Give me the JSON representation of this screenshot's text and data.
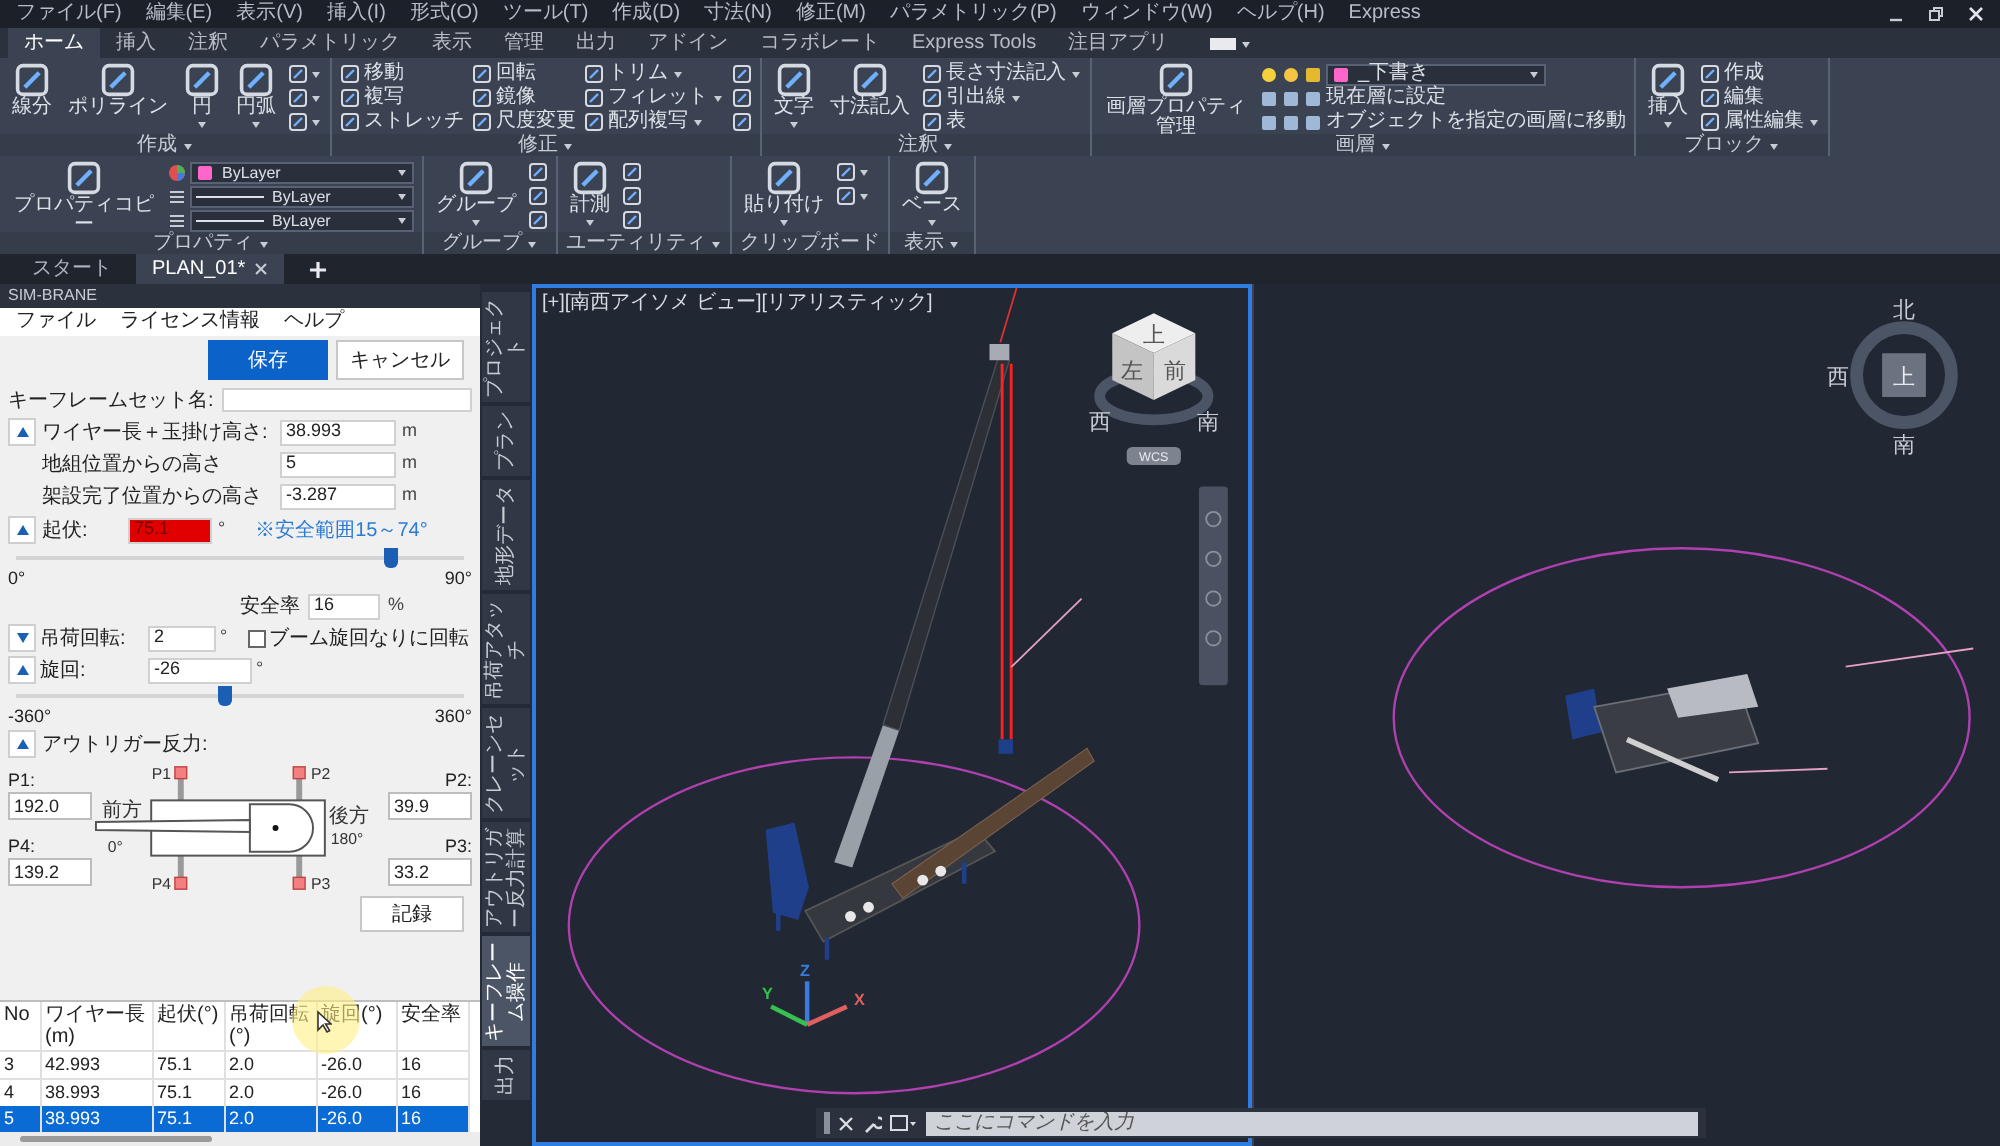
{
  "menu_bar": [
    "ファイル(F)",
    "編集(E)",
    "表示(V)",
    "挿入(I)",
    "形式(O)",
    "ツール(T)",
    "作成(D)",
    "寸法(N)",
    "修正(M)",
    "パラメトリック(P)",
    "ウィンドウ(W)",
    "ヘルプ(H)",
    "Express"
  ],
  "ribbon_tabs": [
    {
      "label": "ホーム",
      "selected": true
    },
    {
      "label": "挿入",
      "selected": false
    },
    {
      "label": "注釈",
      "selected": false
    },
    {
      "label": "パラメトリック",
      "selected": false
    },
    {
      "label": "表示",
      "selected": false
    },
    {
      "label": "管理",
      "selected": false
    },
    {
      "label": "出力",
      "selected": false
    },
    {
      "label": "アドイン",
      "selected": false
    },
    {
      "label": "コラボレート",
      "selected": false
    },
    {
      "label": "Express Tools",
      "selected": false
    },
    {
      "label": "注目アプリ",
      "selected": false
    }
  ],
  "ribbon_groups": [
    {
      "label": "作成",
      "menu": true,
      "columns": [
        [
          {
            "kind": "large",
            "label": "線分",
            "dropdown": false
          }
        ],
        [
          {
            "kind": "large",
            "label": "ポリライン",
            "dropdown": false
          }
        ],
        [
          {
            "kind": "large",
            "label": "円",
            "dropdown": true
          }
        ],
        [
          {
            "kind": "large",
            "label": "円弧",
            "dropdown": true
          }
        ],
        [
          {
            "kind": "icon",
            "dropdown": true
          },
          {
            "kind": "icon",
            "dropdown": true
          },
          {
            "kind": "icon",
            "dropdown": true
          }
        ]
      ]
    },
    {
      "label": "修正",
      "menu": true,
      "columns": [
        [
          {
            "kind": "small",
            "label": "移動",
            "dropdown": false
          },
          {
            "kind": "small",
            "label": "複写",
            "dropdown": false
          },
          {
            "kind": "small",
            "label": "ストレッチ",
            "dropdown": false
          }
        ],
        [
          {
            "kind": "small",
            "label": "回転",
            "dropdown": false
          },
          {
            "kind": "small",
            "label": "鏡像",
            "dropdown": false
          },
          {
            "kind": "small",
            "label": "尺度変更",
            "dropdown": false
          }
        ],
        [
          {
            "kind": "small",
            "label": "トリム",
            "dropdown": true
          },
          {
            "kind": "small",
            "label": "フィレット",
            "dropdown": true
          },
          {
            "kind": "small",
            "label": "配列複写",
            "dropdown": true
          }
        ],
        [
          {
            "kind": "icon",
            "dropdown": false
          },
          {
            "kind": "icon",
            "dropdown": false
          },
          {
            "kind": "icon",
            "dropdown": false
          }
        ]
      ]
    },
    {
      "label": "注釈",
      "menu": true,
      "columns": [
        [
          {
            "kind": "large",
            "label": "文字",
            "dropdown": true
          }
        ],
        [
          {
            "kind": "large",
            "label": "寸法記入",
            "dropdown": false
          }
        ],
        [
          {
            "kind": "small",
            "label": "長さ寸法記入",
            "dropdown": true
          },
          {
            "kind": "small",
            "label": "引出線",
            "dropdown": true
          },
          {
            "kind": "small",
            "label": "表",
            "dropdown": false
          }
        ]
      ]
    },
    {
      "label": "画層",
      "menu": true,
      "columns": [
        [
          {
            "kind": "large",
            "label": "画層プロパティ管理",
            "dropdown": false
          }
        ],
        [
          {
            "kind": "layer-select",
            "value": "_下書き",
            "dropdown": true
          },
          {
            "kind": "layer-tool",
            "label": "現在層に設定",
            "dropdown": false
          },
          {
            "kind": "layer-tool",
            "label": "オブジェクトを指定の画層に移動",
            "dropdown": false
          }
        ]
      ]
    },
    {
      "label": "ブロック",
      "menu": true,
      "columns": [
        [
          {
            "kind": "large",
            "label": "挿入",
            "dropdown": true
          }
        ],
        [
          {
            "kind": "small",
            "label": "作成",
            "dropdown": false
          },
          {
            "kind": "small",
            "label": "編集",
            "dropdown": false
          },
          {
            "kind": "small",
            "label": "属性編集",
            "dropdown": true
          }
        ]
      ]
    },
    {
      "label": "プロパティ",
      "menu": true,
      "columns": [
        [
          {
            "kind": "large",
            "label": "プロパティコピー",
            "dropdown": false
          }
        ],
        [
          {
            "kind": "color-select",
            "value": "ByLayer",
            "dropdown": true
          },
          {
            "kind": "line-select",
            "value": "ByLayer",
            "dropdown": true
          },
          {
            "kind": "line-select",
            "value": "ByLayer",
            "dropdown": true
          }
        ]
      ]
    },
    {
      "label": "グループ",
      "menu": true,
      "columns": [
        [
          {
            "kind": "large",
            "label": "グループ",
            "dropdown": true
          }
        ],
        [
          {
            "kind": "icon",
            "dropdown": false
          },
          {
            "kind": "icon",
            "dropdown": false
          },
          {
            "kind": "icon",
            "dropdown": false
          }
        ]
      ]
    },
    {
      "label": "ユーティリティ",
      "menu": true,
      "columns": [
        [
          {
            "kind": "large",
            "label": "計測",
            "dropdown": true
          }
        ],
        [
          {
            "kind": "icon",
            "dropdown": false
          },
          {
            "kind": "icon",
            "dropdown": false
          },
          {
            "kind": "icon",
            "dropdown": false
          }
        ]
      ]
    },
    {
      "label": "クリップボード",
      "menu": false,
      "columns": [
        [
          {
            "kind": "large",
            "label": "貼り付け",
            "dropdown": true
          }
        ],
        [
          {
            "kind": "icon",
            "dropdown": true
          },
          {
            "kind": "icon",
            "dropdown": true
          }
        ]
      ]
    },
    {
      "label": "表示",
      "menu": true,
      "columns": [
        [
          {
            "kind": "large",
            "label": "ベース",
            "dropdown": true
          }
        ]
      ]
    }
  ],
  "doc_tabs": [
    {
      "label": "スタート",
      "selected": false,
      "closable": false
    },
    {
      "label": "PLAN_01*",
      "selected": true,
      "closable": true
    }
  ],
  "sim_panel": {
    "title": "SIM-BRANE",
    "menus": [
      "ファイル",
      "ライセンス情報",
      "ヘルプ"
    ],
    "buttons": [
      {
        "label": "保存",
        "primary": true
      },
      {
        "label": "キャンセル",
        "primary": false
      }
    ],
    "keyframe_set": {
      "label": "キーフレームセット名:"
    },
    "wire": {
      "expanded": true,
      "rows": [
        {
          "label": "ワイヤー長＋玉掛け高さ:",
          "value": "38.993",
          "unit": "m"
        },
        {
          "label": "地組位置からの高さ",
          "value": "5",
          "unit": "m"
        },
        {
          "label": "架設完了位置からの高さ",
          "value": "-3.287",
          "unit": "m"
        }
      ]
    },
    "luffing": {
      "expanded": true,
      "label": "起伏:",
      "value": "75.1",
      "unit": "°",
      "out_of_range": true,
      "note": "※安全範囲15～74°",
      "level": 0.834,
      "min_label": "0°",
      "max_label": "90°"
    },
    "safety_factor": {
      "label": "安全率",
      "value": "16",
      "unit": "%"
    },
    "load_rotation": {
      "expanded": false,
      "label": "吊荷回転:",
      "value": "2",
      "unit": "°",
      "checkbox": {
        "label": "ブーム旋回なりに回転",
        "checked": false
      }
    },
    "slew": {
      "expanded": true,
      "label": "旋回:",
      "value": "-26",
      "unit": "°",
      "level": 0.464,
      "min_label": "-360°",
      "max_label": "360°"
    },
    "outrigger": {
      "expanded": true,
      "label": "アウトリガー反力:",
      "left_fields": [
        {
          "label": "P1:",
          "value": "192.0"
        },
        {
          "label": "P4:",
          "value": "139.2"
        }
      ],
      "right_fields": [
        {
          "label": "P2:",
          "value": "39.9"
        },
        {
          "label": "P3:",
          "value": "33.2"
        }
      ],
      "pads": [
        "P1",
        "P2",
        "P4",
        "P3"
      ],
      "front": "前方",
      "front_angle": "0°",
      "rear": "後方",
      "rear_angle": "180°"
    },
    "record_button": "記録"
  },
  "table": {
    "columns": [
      "No",
      "ワイヤー長 (m)",
      "起伏(°)",
      "吊荷回転(°)",
      "旋回(°)",
      "安全率"
    ],
    "rows": [
      {
        "cells": [
          "3",
          "42.993",
          "75.1",
          "2.0",
          "-26.0",
          "16"
        ],
        "selected": false
      },
      {
        "cells": [
          "4",
          "38.993",
          "75.1",
          "2.0",
          "-26.0",
          "16"
        ],
        "selected": false
      },
      {
        "cells": [
          "5",
          "38.993",
          "75.1",
          "2.0",
          "-26.0",
          "16"
        ],
        "selected": true
      }
    ]
  },
  "vertical_tabs": [
    {
      "label": "プロジェクト",
      "selected": false
    },
    {
      "label": "プラン",
      "selected": false
    },
    {
      "label": "地形データ",
      "selected": false
    },
    {
      "label": "吊荷アタッチ",
      "selected": false
    },
    {
      "label": "クレーンセット",
      "selected": false
    },
    {
      "label": "アウトリガー反力計算",
      "selected": false
    },
    {
      "label": "キーフレーム操作",
      "selected": true
    },
    {
      "label": "出力",
      "selected": false
    }
  ],
  "viewport_left": {
    "label": "[+][南西アイソメ ビュー][リアリスティック]",
    "active": true,
    "view_cube": {
      "faces": [
        "上",
        "左",
        "前"
      ],
      "compass": [
        "西",
        "南"
      ],
      "ucs_menu": "WCS"
    },
    "axes": [
      "Z",
      "Y",
      "X"
    ]
  },
  "viewport_right": {
    "active": false,
    "compass": {
      "top_face": "上",
      "directions": [
        "北",
        "西",
        "南"
      ]
    }
  },
  "command_line": {
    "placeholder": "ここにコマンドを入力"
  }
}
